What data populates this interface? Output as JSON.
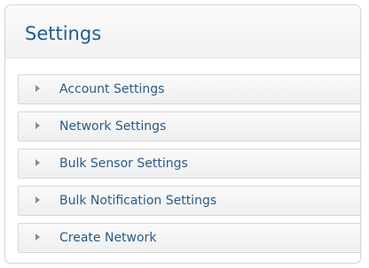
{
  "panel": {
    "title": "Settings",
    "items": [
      {
        "label": "Account Settings",
        "icon": "triangle-right-icon"
      },
      {
        "label": "Network Settings",
        "icon": "triangle-right-icon"
      },
      {
        "label": "Bulk Sensor Settings",
        "icon": "triangle-right-icon"
      },
      {
        "label": "Bulk Notification Settings",
        "icon": "triangle-right-icon"
      },
      {
        "label": "Create Network",
        "icon": "triangle-right-icon"
      }
    ]
  },
  "colors": {
    "title": "#1f5f8f",
    "label": "#2b5b87",
    "arrow": "#8e8e8e",
    "border": "#d7d7d7"
  }
}
